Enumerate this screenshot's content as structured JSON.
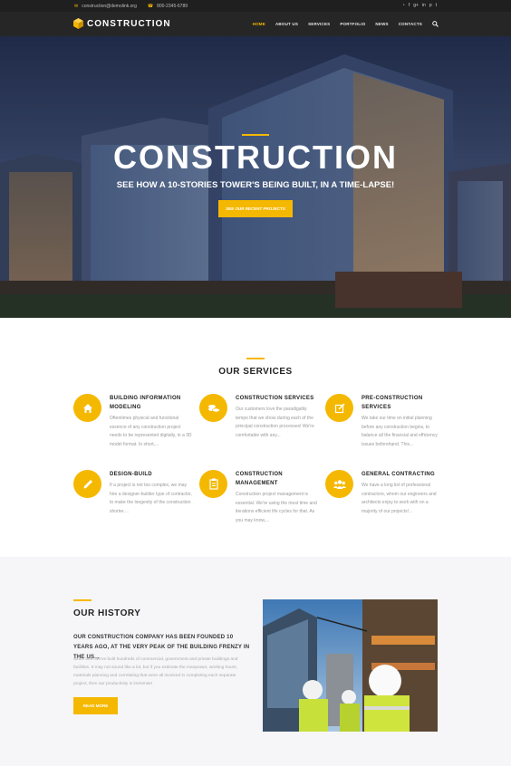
{
  "topbar": {
    "email": "construction@demolink.org",
    "phone": "800-2345-6789",
    "social": [
      "rss-icon",
      "facebook-icon",
      "google-plus-icon",
      "linkedin-icon",
      "pinterest-icon",
      "twitter-icon"
    ],
    "social_glyphs": [
      "◔",
      "f",
      "g+",
      "in",
      "p",
      "t"
    ]
  },
  "header": {
    "logo_text": "CONSTRUCTION",
    "nav": [
      "HOME",
      "ABOUT US",
      "SERVICES",
      "PORTFOLIO",
      "NEWS",
      "CONTACTS"
    ]
  },
  "hero": {
    "title": "CONSTRUCTION",
    "subtitle": "SEE HOW A 10-STORIES TOWER'S BEING BUILT, IN A TIME-LAPSE!",
    "button": "SEE OUR RECENT PROJECTS"
  },
  "services": {
    "heading": "OUR SERVICES",
    "items": [
      {
        "title": "BUILDING INFORMATION MODELING",
        "desc": "Oftentimes physical and functional essence of any construction project needs to be represented digitally, in a 3D model format. In short,...",
        "icon": "home-icon"
      },
      {
        "title": "CONSTRUCTION SERVICES",
        "desc": "Our customers love the paradigality tempo that we show during each of the principal construction processes! We're comfortable with any...",
        "icon": "coins-icon"
      },
      {
        "title": "PRE-CONSTRUCTION SERVICES",
        "desc": "We take our time on initial planning before any construction begins, to balance all the financial and efficiency issues beforehand. This...",
        "icon": "edit-icon"
      },
      {
        "title": "DESIGN-BUILD",
        "desc": "If a project is not too complex, we may hire a designer-builder type of contractor, to make the longevity of the construction shorter....",
        "icon": "pencil-icon"
      },
      {
        "title": "CONSTRUCTION MANAGEMENT",
        "desc": "Construction project management is essential. We're using the most time and iterations efficient life cycles for that. As you may know,...",
        "icon": "clipboard-icon"
      },
      {
        "title": "GENERAL CONTRACTING",
        "desc": "We have a long list of professional contractors, whom our engineers and architects enjoy to work with on a majority of our projects!...",
        "icon": "team-icon"
      }
    ]
  },
  "history": {
    "heading": "OUR HISTORY",
    "lead": "OUR CONSTRUCTION COMPANY HAS BEEN FOUNDED 10 YEARS AGO, AT THE VERY PEAK OF THE BUILDING FRENZY IN THE US...",
    "body": "Since then we've built hundreds of commercial, government and private buildings and facilities. It may not sound like a lot, but if you estimate the manpower, working hours, materials planning and correlating that were all involved in completing each separate project, then our productivity is immense!",
    "button": "READ MORE"
  },
  "colors": {
    "accent": "#f5b800",
    "dark": "#262626"
  }
}
